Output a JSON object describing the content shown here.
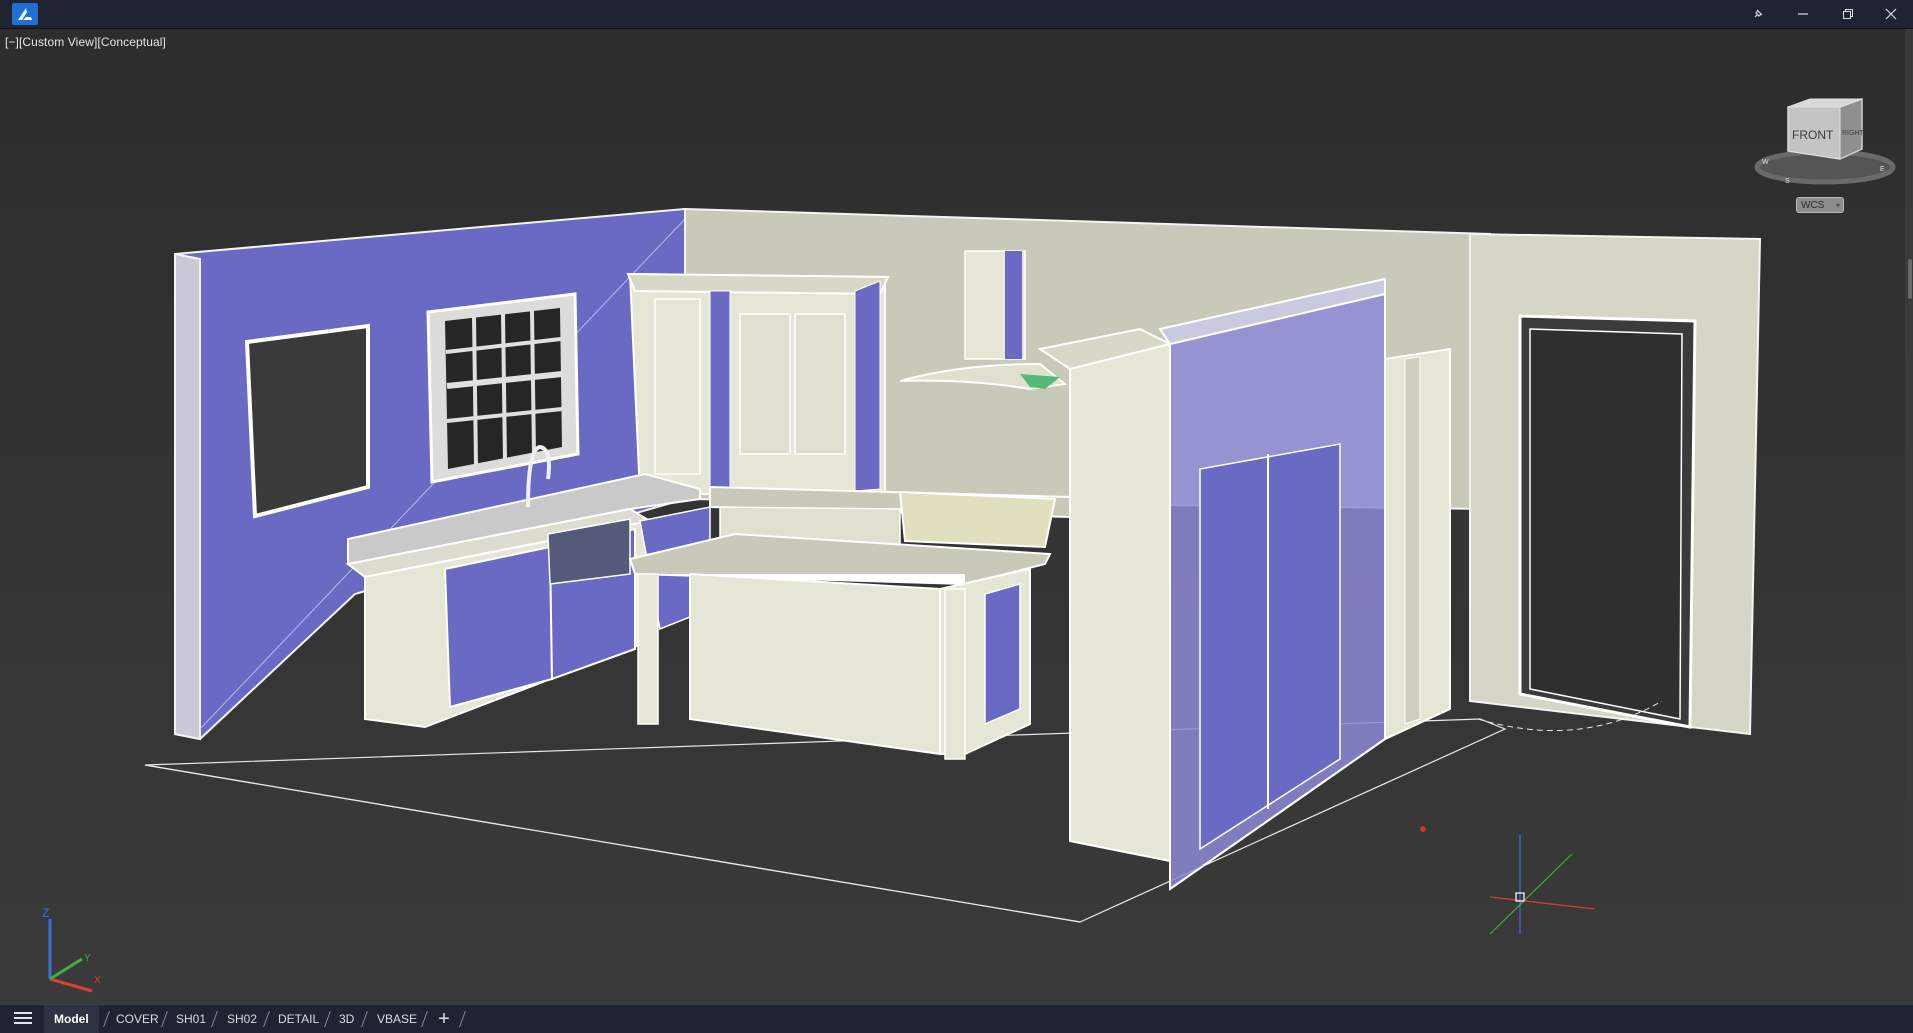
{
  "titlebar": {
    "logo_icon": "autocad-a-logo-icon",
    "buttons": [
      {
        "name": "pin-button",
        "icon": "pin-icon"
      },
      {
        "name": "minimize-button",
        "icon": "minimize-icon"
      },
      {
        "name": "restore-button",
        "icon": "restore-icon"
      },
      {
        "name": "close-button",
        "icon": "close-icon"
      }
    ]
  },
  "viewport": {
    "view_label": "[−][Custom View][Conceptual]",
    "viewcube": {
      "front_label": "FRONT",
      "right_label": "RIGHT",
      "compass_labels": [
        "W",
        "S",
        "E"
      ]
    },
    "wcs_label": "WCS",
    "ucs_axes": {
      "x": "X",
      "y": "Y",
      "z": "Z"
    }
  },
  "tabs": {
    "menu_icon": "hamburger-menu-icon",
    "items": [
      "Model",
      "COVER",
      "SH01",
      "SH02",
      "DETAIL",
      "3D",
      "VBASE"
    ],
    "active": "Model",
    "add_icon": "plus-icon",
    "add_label": "+"
  },
  "colors": {
    "wall_purple": "#6b6bc7",
    "cream": "#e6e6d6",
    "titlebar": "#1f2430",
    "viewport_bg": "#2d2d2d",
    "wireframe": "#ffffff"
  }
}
